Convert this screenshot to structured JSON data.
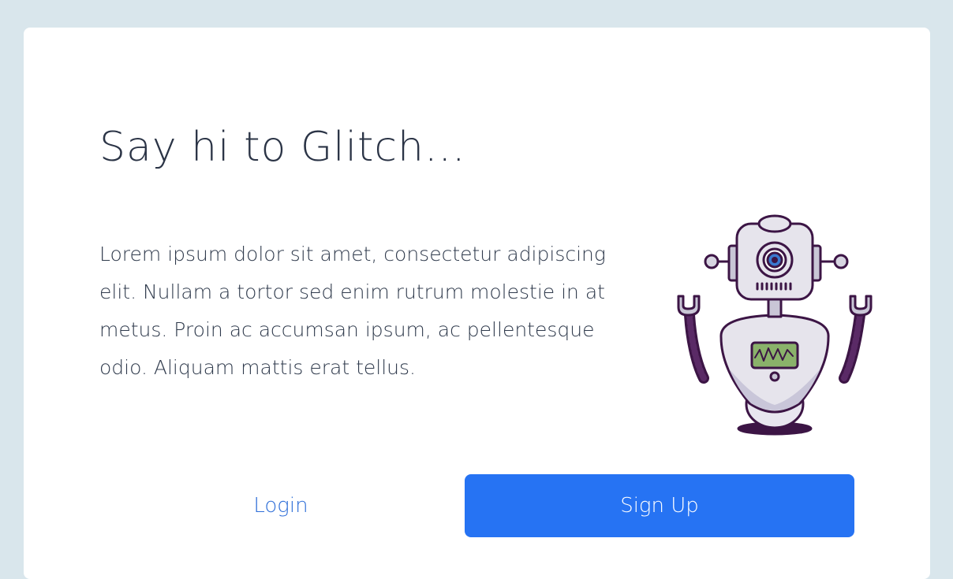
{
  "card": {
    "title": "Say hi to Glitch...",
    "description": "Lorem ipsum dolor sit amet, consectetur adipiscing elit. Nullam a tortor sed enim rutrum molestie in at metus. Proin ac accumsan ipsum, ac pellentesque odio. Aliquam mattis erat tellus."
  },
  "actions": {
    "login_label": "Login",
    "signup_label": "Sign Up"
  },
  "illustration": {
    "icon": "robot-icon"
  },
  "colors": {
    "background": "#d9e6ec",
    "card": "#ffffff",
    "primary": "#2673f3",
    "link": "#2f6fd8",
    "text": "#2b3446",
    "robot_outline": "#3c1545"
  }
}
